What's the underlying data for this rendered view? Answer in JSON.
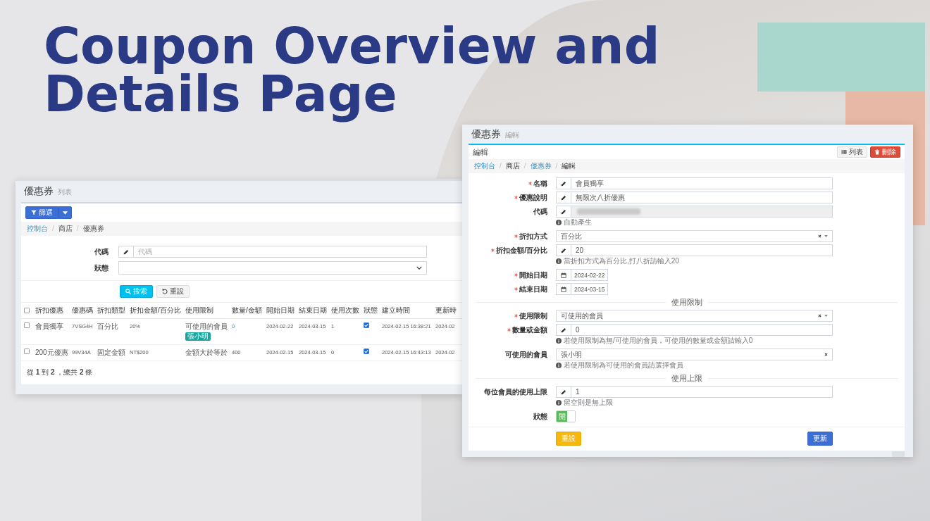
{
  "title": "Coupon Overview and Details Page",
  "list_page": {
    "header": {
      "title": "優惠券",
      "subtitle": "列表"
    },
    "filter_button": {
      "label": "篩選"
    },
    "breadcrumb": {
      "separator": "/",
      "items": [
        {
          "label": "控制台",
          "link": true
        },
        {
          "label": "商店",
          "link": false
        },
        {
          "label": "優惠券",
          "link": false
        }
      ]
    },
    "filters": [
      {
        "label": "代碼",
        "kind": "text",
        "placeholder": "代碼"
      },
      {
        "label": "狀態",
        "kind": "select"
      }
    ],
    "buttons": [
      {
        "label": "搜索",
        "kind": "search"
      },
      {
        "label": "重設",
        "kind": "reset"
      }
    ],
    "table": {
      "select_all": {
        "checked": false
      },
      "columns": [
        "折扣優惠",
        "優惠碼",
        "折扣類型",
        "折扣金額/百分比",
        "使用限制",
        "數量/金額",
        "開始日期",
        "結束日期",
        "使用次數",
        "狀態",
        "建立時間",
        "更新時"
      ],
      "rows": [
        {
          "checked": false,
          "cells": [
            {
              "kind": "text",
              "text": "會員獨享"
            },
            {
              "kind": "text",
              "text": "7VSG4H"
            },
            {
              "kind": "text",
              "text": "百分比"
            },
            {
              "kind": "text",
              "text": "20%"
            },
            {
              "kind": "text",
              "text": "可使用的會員",
              "tags": [
                "張小明"
              ]
            },
            {
              "kind": "link",
              "text": "0"
            },
            {
              "kind": "text",
              "text": "2024-02-22"
            },
            {
              "kind": "text",
              "text": "2024-03-15"
            },
            {
              "kind": "text",
              "text": "1"
            },
            {
              "kind": "check",
              "checked": true
            },
            {
              "kind": "text",
              "text": "2024-02-15 16:38:21"
            },
            {
              "kind": "text",
              "text": "2024-02"
            }
          ]
        },
        {
          "checked": false,
          "cells": [
            {
              "kind": "text",
              "text": "200元優惠"
            },
            {
              "kind": "text",
              "text": "99V34A"
            },
            {
              "kind": "text",
              "text": "固定金額"
            },
            {
              "kind": "text",
              "text": "NT$200"
            },
            {
              "kind": "text",
              "text": "金額大於等於"
            },
            {
              "kind": "text",
              "text": "400"
            },
            {
              "kind": "text",
              "text": "2024-02-15"
            },
            {
              "kind": "text",
              "text": "2024-03-15"
            },
            {
              "kind": "text",
              "text": "0"
            },
            {
              "kind": "check",
              "checked": true
            },
            {
              "kind": "text",
              "text": "2024-02-15 16:43:13"
            },
            {
              "kind": "text",
              "text": "2024-02"
            }
          ]
        }
      ]
    },
    "summary": "從 **1** 到 **2** ，總共 **2** 條"
  },
  "edit_page": {
    "header": {
      "title": "優惠券",
      "subtitle": "編輯"
    },
    "box_title": "編輯",
    "box_buttons": [
      {
        "label": "列表",
        "kind": "list"
      },
      {
        "label": "刪除",
        "kind": "delete"
      }
    ],
    "breadcrumb": {
      "separator": "/",
      "items": [
        {
          "label": "控制台",
          "link": true
        },
        {
          "label": "商店",
          "link": false
        },
        {
          "label": "優惠券",
          "link": true
        },
        {
          "label": "編輯",
          "link": false
        }
      ]
    },
    "form": [
      {
        "kind": "text",
        "label": "名稱",
        "required": true,
        "value": "會員獨享"
      },
      {
        "kind": "text",
        "label": "優惠說明",
        "required": true,
        "value": "無限次八折優惠"
      },
      {
        "kind": "redacted",
        "label": "代碼",
        "required": false,
        "help": "自動產生"
      },
      {
        "kind": "select",
        "label": "折扣方式",
        "required": true,
        "value": "百分比"
      },
      {
        "kind": "text",
        "label": "折扣金額/百分比",
        "required": true,
        "value": "20",
        "help": "當折扣方式為百分比,打八折請輸入20"
      },
      {
        "kind": "date",
        "label": "開始日期",
        "required": true,
        "value": "2024-02-22"
      },
      {
        "kind": "date",
        "label": "結束日期",
        "required": true,
        "value": "2024-03-15"
      },
      {
        "kind": "section",
        "title": "使用限制"
      },
      {
        "kind": "select",
        "label": "使用限制",
        "required": true,
        "value": "可使用的會員"
      },
      {
        "kind": "text",
        "label": "數量或金額",
        "required": true,
        "value": "0",
        "help": "若使用限制為無/可使用的會員，可使用的數量或金額請輸入0"
      },
      {
        "kind": "multiselect",
        "label": "可使用的會員",
        "required": false,
        "value": "張小明",
        "help": "若使用限制為可使用的會員請選擇會員"
      },
      {
        "kind": "section",
        "title": "使用上限"
      },
      {
        "kind": "text",
        "label": "每位會員的使用上限",
        "required": false,
        "value": "1",
        "help": "留空則是無上限"
      },
      {
        "kind": "toggle",
        "label": "狀態",
        "required": false,
        "on": true,
        "toggle_label": "開"
      }
    ],
    "footer_buttons": [
      {
        "label": "重設",
        "kind": "reset"
      },
      {
        "label": "更新",
        "kind": "submit"
      }
    ]
  }
}
